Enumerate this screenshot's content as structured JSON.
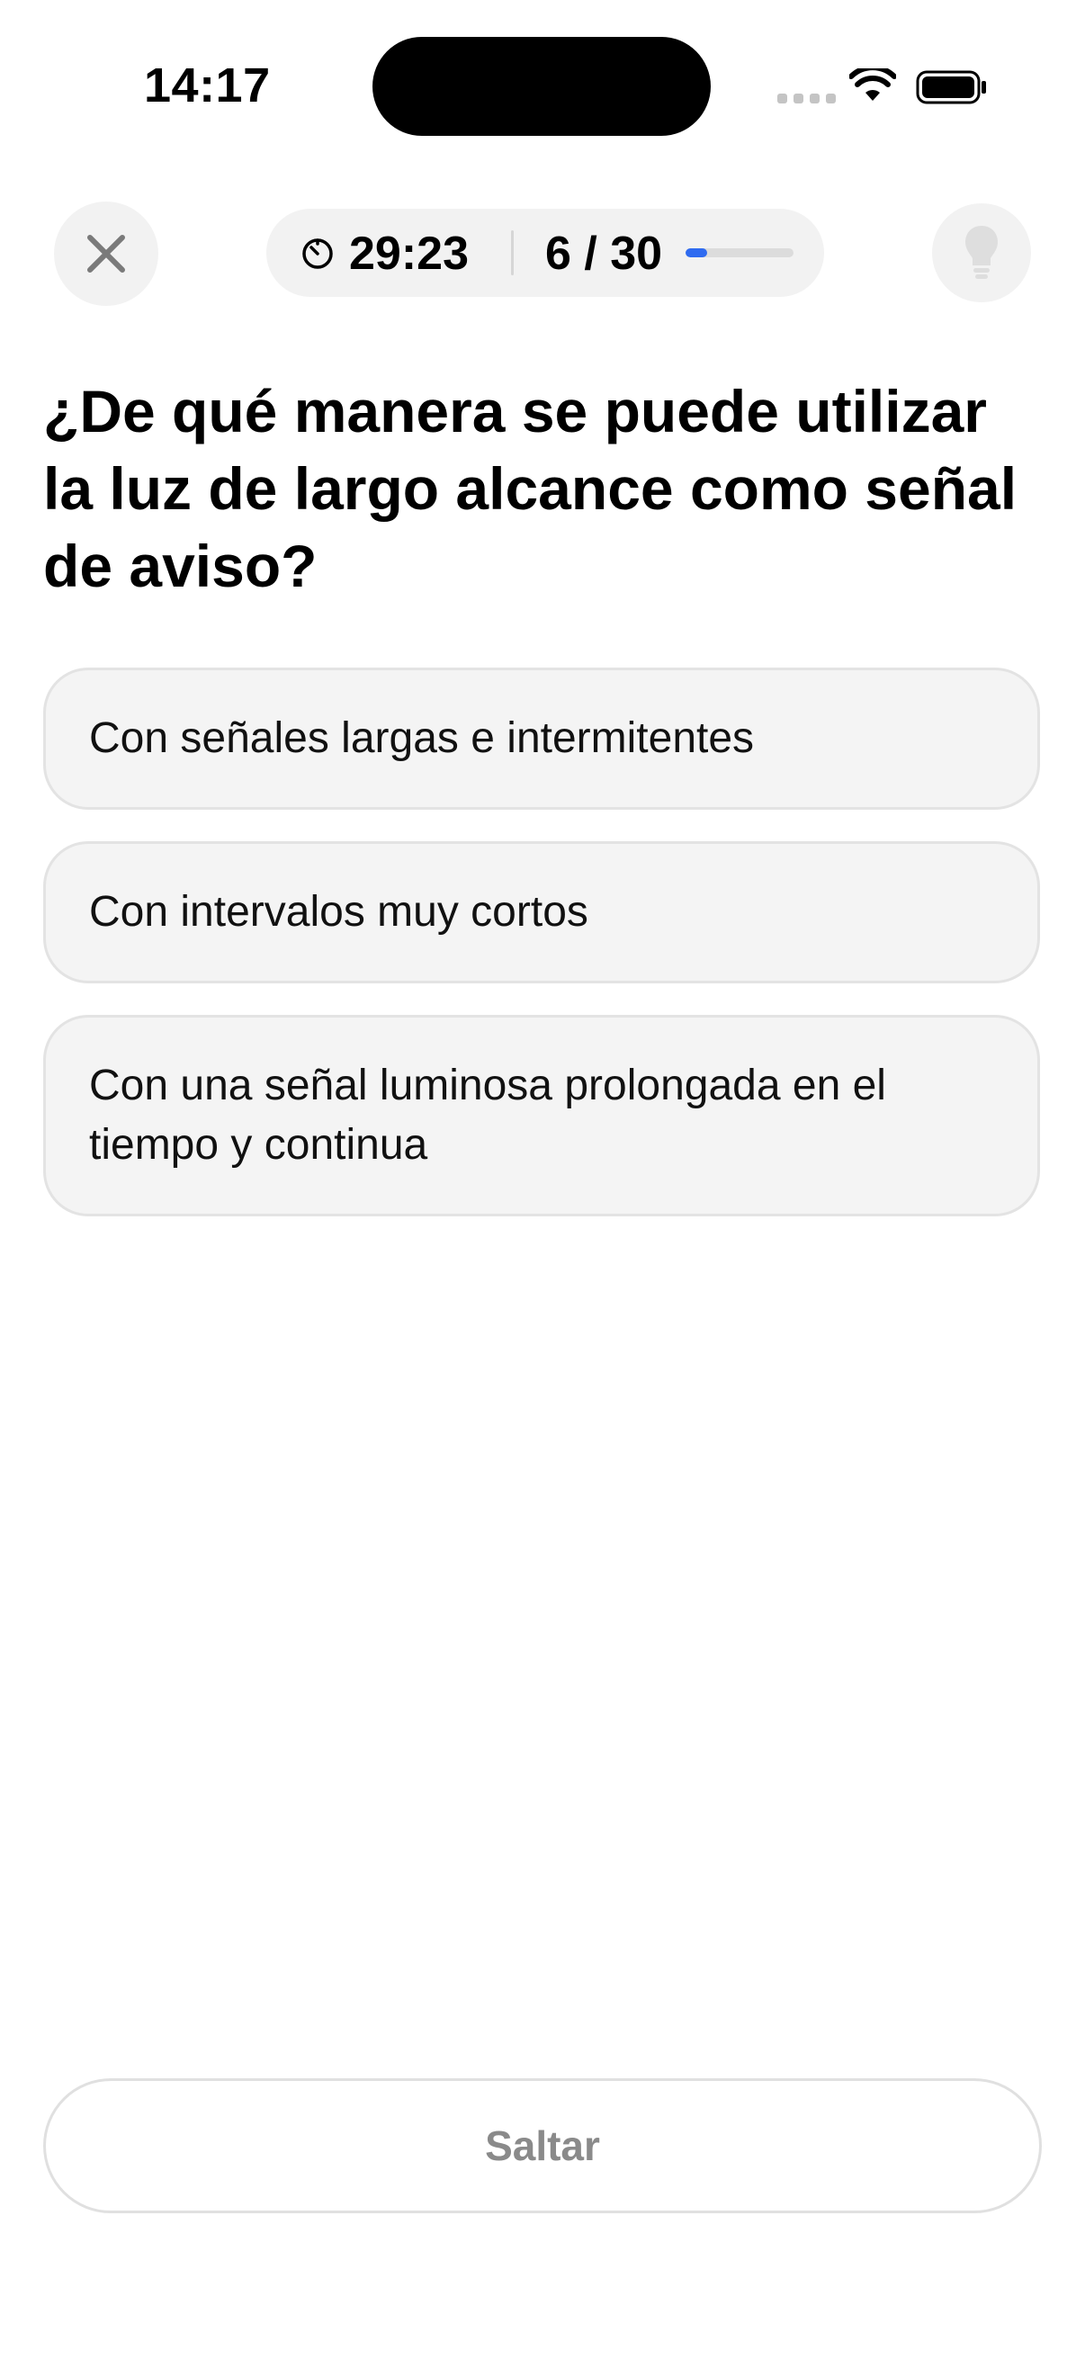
{
  "status_bar": {
    "time": "14:17"
  },
  "header": {
    "close_icon": "close-icon",
    "timer_icon": "timer-icon",
    "timer": "29:23",
    "counter": "6 / 30",
    "progress_fraction": 0.2,
    "hint_icon": "lightbulb-icon"
  },
  "question": {
    "text": "¿De qué manera se puede utilizar la luz de largo alcance como señal de aviso?"
  },
  "answers": [
    {
      "label": "Con señales largas e intermitentes"
    },
    {
      "label": "Con intervalos muy cortos"
    },
    {
      "label": "Con una señal luminosa prolongada en el tiempo y continua"
    }
  ],
  "footer": {
    "skip_label": "Saltar"
  },
  "colors": {
    "accent": "#2f6bf0",
    "pill_background": "#f2f2f2",
    "answer_background": "#f4f4f4",
    "skip_text": "#8a8a8a"
  }
}
